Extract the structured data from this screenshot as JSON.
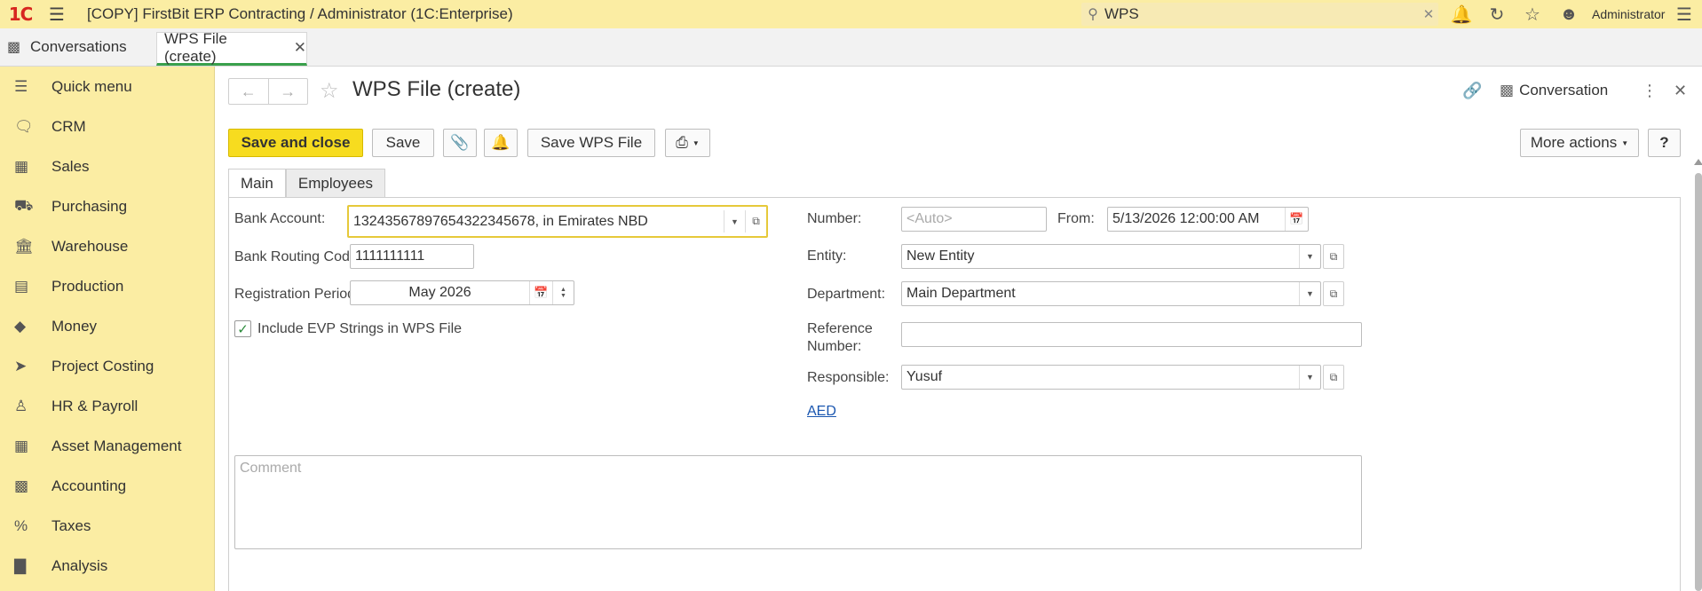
{
  "titlebar": {
    "logo": "1C",
    "title": "[COPY] FirstBit ERP Contracting / Administrator  (1C:Enterprise)",
    "search_value": "WPS",
    "user": "Administrator"
  },
  "tabs": {
    "conversations": "Conversations",
    "active": "WPS File (create)"
  },
  "sidebar": {
    "items": [
      {
        "label": "Quick menu",
        "icon": "menu-icon"
      },
      {
        "label": "CRM",
        "icon": "chat-icon"
      },
      {
        "label": "Sales",
        "icon": "basket-icon"
      },
      {
        "label": "Purchasing",
        "icon": "truck-icon"
      },
      {
        "label": "Warehouse",
        "icon": "warehouse-icon"
      },
      {
        "label": "Production",
        "icon": "factory-icon"
      },
      {
        "label": "Money",
        "icon": "money-icon"
      },
      {
        "label": "Project Costing",
        "icon": "rocket-icon"
      },
      {
        "label": "HR & Payroll",
        "icon": "person-icon"
      },
      {
        "label": "Asset Management",
        "icon": "asset-icon"
      },
      {
        "label": "Accounting",
        "icon": "calculator-icon"
      },
      {
        "label": "Taxes",
        "icon": "percent-icon"
      },
      {
        "label": "Analysis",
        "icon": "chart-icon"
      }
    ]
  },
  "form": {
    "title": "WPS File (create)",
    "conversation_label": "Conversation",
    "toolbar": {
      "save_close": "Save and close",
      "save": "Save",
      "save_wps": "Save WPS File",
      "more_actions": "More actions",
      "help": "?"
    },
    "tabs": [
      "Main",
      "Employees"
    ],
    "fields": {
      "bank_account_label": "Bank Account:",
      "bank_account_value": "132435678976543223456​78, in Emirates NBD",
      "routing_label": "Bank Routing Code:",
      "routing_value": "1111111111",
      "period_label": "Registration Period:",
      "period_value": "May 2026",
      "include_evp_label": "Include EVP Strings in WPS File",
      "include_evp_checked": true,
      "number_label": "Number:",
      "number_placeholder": "<Auto>",
      "from_label": "From:",
      "from_value": "5/13/2026 12:00:00 AM",
      "entity_label": "Entity:",
      "entity_value": "New Entity",
      "department_label": "Department:",
      "department_value": "Main Department",
      "reference_label_1": "Reference",
      "reference_label_2": "Number:",
      "reference_value": "",
      "responsible_label": "Responsible:",
      "responsible_value": "Yusuf",
      "currency_link": "AED",
      "comment_placeholder": "Comment"
    }
  },
  "colors": {
    "titlebar_bg": "#fbeda3",
    "primary_button": "#f7dc1f",
    "active_tab_underline": "#3aa04c",
    "link": "#1a56b0"
  }
}
